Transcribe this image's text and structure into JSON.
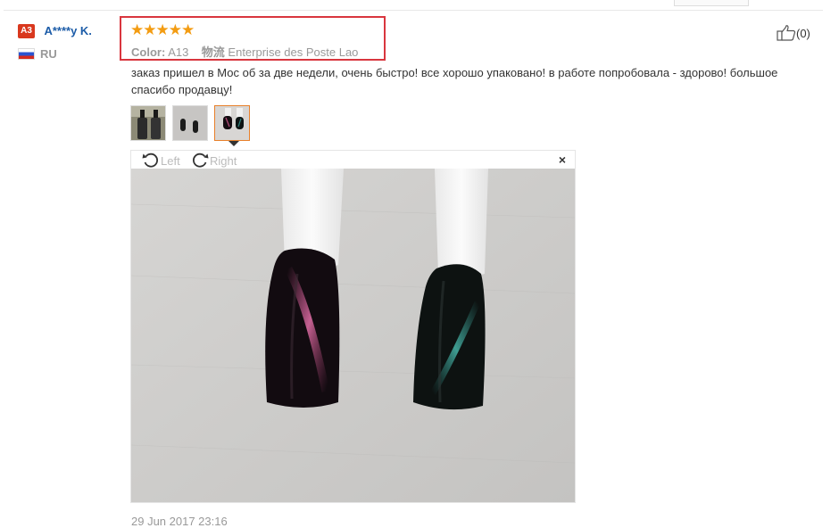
{
  "review": {
    "user_badge": "A3",
    "user_name": "A****y K.",
    "country": "RU",
    "rating_stars": "★★★★★",
    "rating": 5,
    "color_label": "Color:",
    "color_value": "A13",
    "shipping_label": "物流",
    "shipping_value": "Enterprise des Poste Lao",
    "like_count": "(0)",
    "text": "заказ пришел в Мос об за две недели, очень быстро! все хорошо упаковано! в работе попробовала - здорово! большое спасибо продавцу!",
    "date": "29 Jun 2017 23:16"
  },
  "viewer": {
    "rotate_left": "Left",
    "rotate_right": "Right",
    "close": "×"
  },
  "colors": {
    "highlight_border": "#d9363e",
    "star": "#f39c12",
    "username": "#1c5ca8",
    "selected_thumb": "#e8802a"
  }
}
